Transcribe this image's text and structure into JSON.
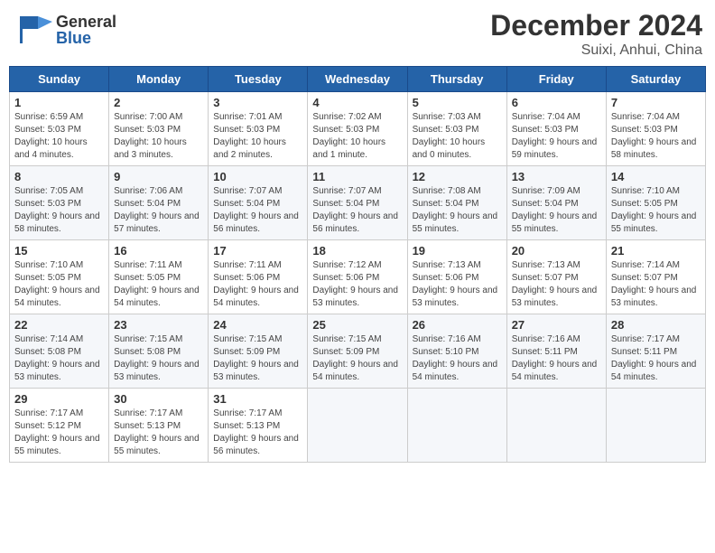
{
  "header": {
    "logo_general": "General",
    "logo_blue": "Blue",
    "month_title": "December 2024",
    "location": "Suixi, Anhui, China"
  },
  "weekdays": [
    "Sunday",
    "Monday",
    "Tuesday",
    "Wednesday",
    "Thursday",
    "Friday",
    "Saturday"
  ],
  "days": [
    {
      "date": "1",
      "sunrise": "6:59 AM",
      "sunset": "5:03 PM",
      "daylight": "Daylight: 10 hours and 4 minutes."
    },
    {
      "date": "2",
      "sunrise": "7:00 AM",
      "sunset": "5:03 PM",
      "daylight": "Daylight: 10 hours and 3 minutes."
    },
    {
      "date": "3",
      "sunrise": "7:01 AM",
      "sunset": "5:03 PM",
      "daylight": "Daylight: 10 hours and 2 minutes."
    },
    {
      "date": "4",
      "sunrise": "7:02 AM",
      "sunset": "5:03 PM",
      "daylight": "Daylight: 10 hours and 1 minute."
    },
    {
      "date": "5",
      "sunrise": "7:03 AM",
      "sunset": "5:03 PM",
      "daylight": "Daylight: 10 hours and 0 minutes."
    },
    {
      "date": "6",
      "sunrise": "7:04 AM",
      "sunset": "5:03 PM",
      "daylight": "Daylight: 9 hours and 59 minutes."
    },
    {
      "date": "7",
      "sunrise": "7:04 AM",
      "sunset": "5:03 PM",
      "daylight": "Daylight: 9 hours and 58 minutes."
    },
    {
      "date": "8",
      "sunrise": "7:05 AM",
      "sunset": "5:03 PM",
      "daylight": "Daylight: 9 hours and 58 minutes."
    },
    {
      "date": "9",
      "sunrise": "7:06 AM",
      "sunset": "5:04 PM",
      "daylight": "Daylight: 9 hours and 57 minutes."
    },
    {
      "date": "10",
      "sunrise": "7:07 AM",
      "sunset": "5:04 PM",
      "daylight": "Daylight: 9 hours and 56 minutes."
    },
    {
      "date": "11",
      "sunrise": "7:07 AM",
      "sunset": "5:04 PM",
      "daylight": "Daylight: 9 hours and 56 minutes."
    },
    {
      "date": "12",
      "sunrise": "7:08 AM",
      "sunset": "5:04 PM",
      "daylight": "Daylight: 9 hours and 55 minutes."
    },
    {
      "date": "13",
      "sunrise": "7:09 AM",
      "sunset": "5:04 PM",
      "daylight": "Daylight: 9 hours and 55 minutes."
    },
    {
      "date": "14",
      "sunrise": "7:10 AM",
      "sunset": "5:05 PM",
      "daylight": "Daylight: 9 hours and 55 minutes."
    },
    {
      "date": "15",
      "sunrise": "7:10 AM",
      "sunset": "5:05 PM",
      "daylight": "Daylight: 9 hours and 54 minutes."
    },
    {
      "date": "16",
      "sunrise": "7:11 AM",
      "sunset": "5:05 PM",
      "daylight": "Daylight: 9 hours and 54 minutes."
    },
    {
      "date": "17",
      "sunrise": "7:11 AM",
      "sunset": "5:06 PM",
      "daylight": "Daylight: 9 hours and 54 minutes."
    },
    {
      "date": "18",
      "sunrise": "7:12 AM",
      "sunset": "5:06 PM",
      "daylight": "Daylight: 9 hours and 53 minutes."
    },
    {
      "date": "19",
      "sunrise": "7:13 AM",
      "sunset": "5:06 PM",
      "daylight": "Daylight: 9 hours and 53 minutes."
    },
    {
      "date": "20",
      "sunrise": "7:13 AM",
      "sunset": "5:07 PM",
      "daylight": "Daylight: 9 hours and 53 minutes."
    },
    {
      "date": "21",
      "sunrise": "7:14 AM",
      "sunset": "5:07 PM",
      "daylight": "Daylight: 9 hours and 53 minutes."
    },
    {
      "date": "22",
      "sunrise": "7:14 AM",
      "sunset": "5:08 PM",
      "daylight": "Daylight: 9 hours and 53 minutes."
    },
    {
      "date": "23",
      "sunrise": "7:15 AM",
      "sunset": "5:08 PM",
      "daylight": "Daylight: 9 hours and 53 minutes."
    },
    {
      "date": "24",
      "sunrise": "7:15 AM",
      "sunset": "5:09 PM",
      "daylight": "Daylight: 9 hours and 53 minutes."
    },
    {
      "date": "25",
      "sunrise": "7:15 AM",
      "sunset": "5:09 PM",
      "daylight": "Daylight: 9 hours and 54 minutes."
    },
    {
      "date": "26",
      "sunrise": "7:16 AM",
      "sunset": "5:10 PM",
      "daylight": "Daylight: 9 hours and 54 minutes."
    },
    {
      "date": "27",
      "sunrise": "7:16 AM",
      "sunset": "5:11 PM",
      "daylight": "Daylight: 9 hours and 54 minutes."
    },
    {
      "date": "28",
      "sunrise": "7:17 AM",
      "sunset": "5:11 PM",
      "daylight": "Daylight: 9 hours and 54 minutes."
    },
    {
      "date": "29",
      "sunrise": "7:17 AM",
      "sunset": "5:12 PM",
      "daylight": "Daylight: 9 hours and 55 minutes."
    },
    {
      "date": "30",
      "sunrise": "7:17 AM",
      "sunset": "5:13 PM",
      "daylight": "Daylight: 9 hours and 55 minutes."
    },
    {
      "date": "31",
      "sunrise": "7:17 AM",
      "sunset": "5:13 PM",
      "daylight": "Daylight: 9 hours and 56 minutes."
    }
  ]
}
